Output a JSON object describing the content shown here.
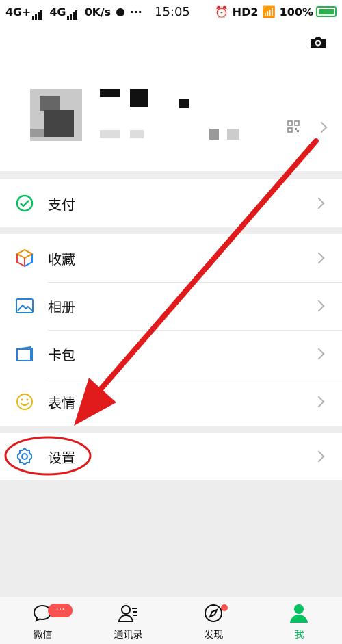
{
  "status": {
    "network_left": "4G+",
    "network_right": "4G",
    "speed": "0K/s",
    "dots": "···",
    "time": "15:05",
    "hd": "HD2",
    "battery": "100%"
  },
  "menu": {
    "pay": "支付",
    "favorites": "收藏",
    "album": "相册",
    "cards": "卡包",
    "stickers": "表情",
    "settings": "设置"
  },
  "tabbar": {
    "chats": "微信",
    "chats_badge": "···",
    "contacts": "通讯录",
    "discover": "发现",
    "me": "我"
  },
  "colors": {
    "accent": "#07c160",
    "annotation": "#e11b1b",
    "badge": "#fa5151"
  }
}
